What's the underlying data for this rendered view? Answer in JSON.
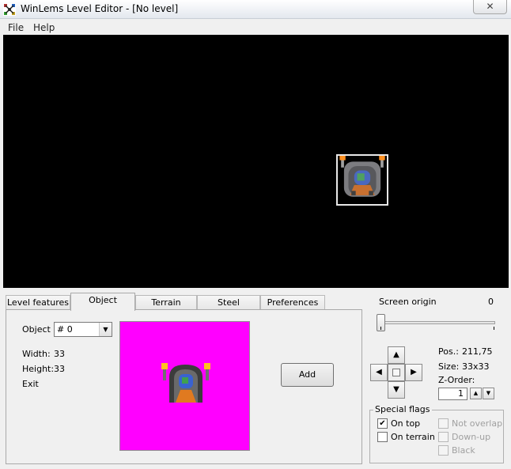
{
  "window": {
    "title": "WinLems Level Editor - [No level]",
    "close_glyph": "✕"
  },
  "menu": {
    "items": [
      {
        "label": "File"
      },
      {
        "label": "Help"
      }
    ]
  },
  "tabs": [
    {
      "label": "Level features",
      "active": false
    },
    {
      "label": "Object",
      "active": true
    },
    {
      "label": "Terrain",
      "active": false
    },
    {
      "label": "Steel",
      "active": false
    },
    {
      "label": "Preferences",
      "active": false
    }
  ],
  "object_panel": {
    "object_label": "Object",
    "object_value": "# 0",
    "width_label": "Width:",
    "width_value": "33",
    "height_label": "Height:",
    "height_value": "33",
    "type_text": "Exit",
    "add_button": "Add",
    "preview_background": "#ff00ff"
  },
  "screen_origin": {
    "label": "Screen origin",
    "value": "0"
  },
  "position": {
    "pos_label": "Pos.:",
    "pos_value": "211,75",
    "size_label": "Size:",
    "size_value": "33x33",
    "zorder_label": "Z-Order:",
    "zorder_value": "1"
  },
  "special_flags": {
    "title": "Special flags",
    "flags": [
      {
        "label": "On top",
        "checked": true,
        "enabled": true
      },
      {
        "label": "On terrain",
        "checked": false,
        "enabled": true
      },
      {
        "label": "Not overlap",
        "checked": false,
        "enabled": false
      },
      {
        "label": "Down-up",
        "checked": false,
        "enabled": false
      },
      {
        "label": "Black",
        "checked": false,
        "enabled": false
      }
    ]
  },
  "icons": {
    "app": "winlems-app-icon",
    "dropdown": "chevron-down-icon",
    "nav_up": "arrow-up-icon",
    "nav_down": "arrow-down-icon",
    "nav_left": "arrow-left-icon",
    "nav_right": "arrow-right-icon",
    "check": "checkmark-icon"
  },
  "colors": {
    "canvas": "#000000",
    "preview": "#ff00ff"
  }
}
